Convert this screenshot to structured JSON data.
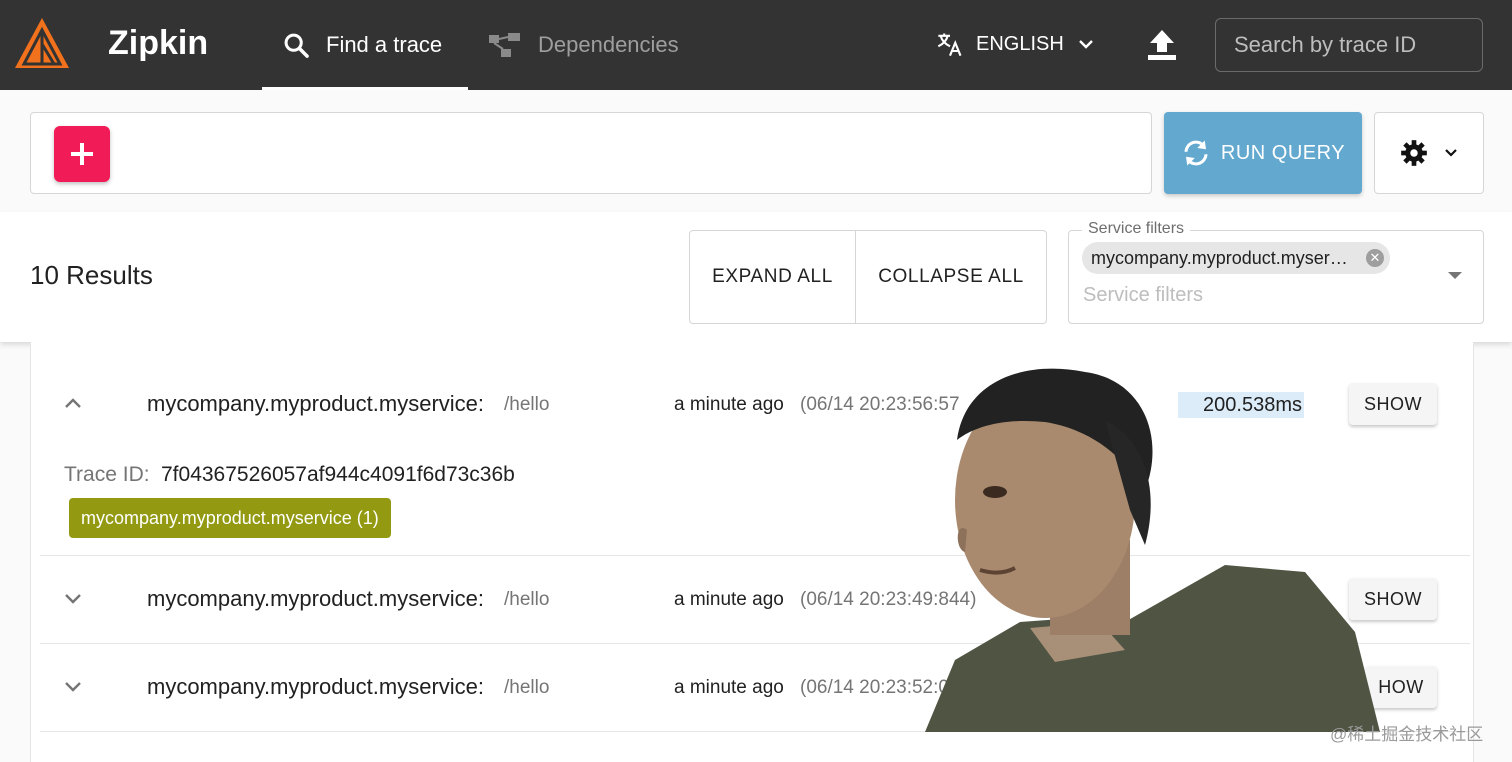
{
  "app": {
    "brand": "Zipkin",
    "nav": {
      "find_trace": "Find a trace",
      "dependencies": "Dependencies"
    },
    "language": "ENGLISH",
    "search_placeholder": "Search by trace ID"
  },
  "query": {
    "run_label": "RUN QUERY"
  },
  "results": {
    "count_label": "10 Results",
    "expand_all": "EXPAND ALL",
    "collapse_all": "COLLAPSE ALL",
    "service_filters": {
      "legend": "Service filters",
      "chip": "mycompany.myproduct.myservice",
      "placeholder": "Service filters"
    }
  },
  "traces": [
    {
      "service": "mycompany.myproduct.myservice:",
      "span": "/hello",
      "ago": "a minute ago",
      "timestamp": "(06/14 20:23:56:57",
      "duration": "200.538ms",
      "show": "SHOW",
      "expanded": true,
      "trace_id_label": "Trace ID:",
      "trace_id": "7f04367526057af944c4091f6d73c36b",
      "badge": "mycompany.myproduct.myservice (1)"
    },
    {
      "service": "mycompany.myproduct.myservice:",
      "span": "/hello",
      "ago": "a minute ago",
      "timestamp": "(06/14 20:23:49:844)",
      "show": "SHOW",
      "expanded": false
    },
    {
      "service": "mycompany.myproduct.myservice:",
      "span": "/hello",
      "ago": "a minute ago",
      "timestamp": "(06/14 20:23:52:0",
      "show": "HOW",
      "expanded": false
    }
  ],
  "watermark": "@稀土掘金技术社区",
  "colors": {
    "appbar": "#333333",
    "add_button": "#f11b57",
    "run_button": "#63a8cf",
    "service_badge": "#939a12",
    "duration_bar": "#dcecf8",
    "logo": "#f2711c"
  }
}
